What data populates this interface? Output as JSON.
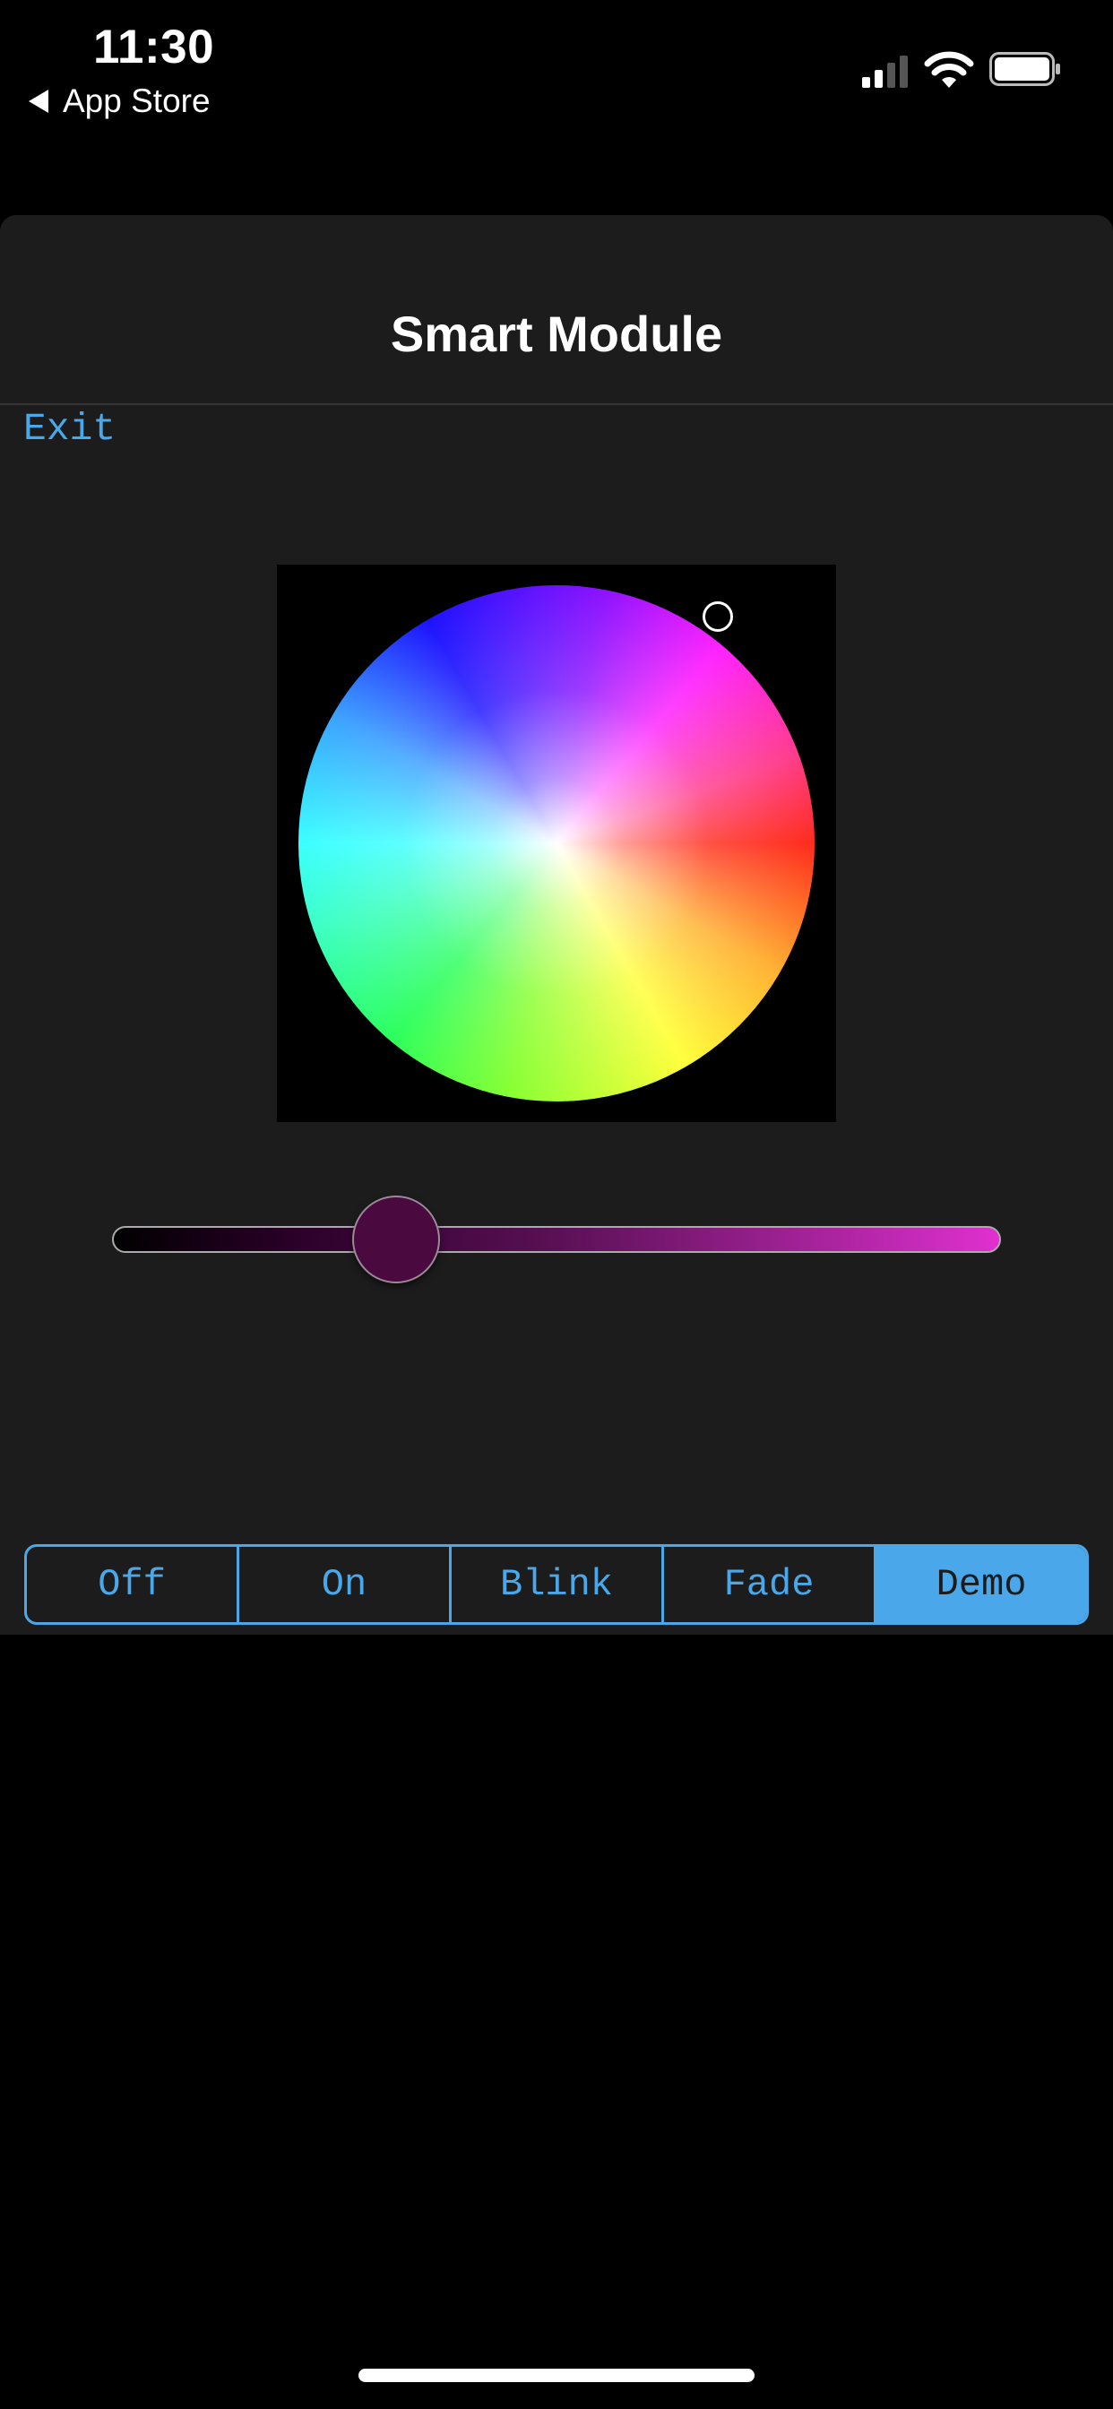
{
  "status_bar": {
    "time": "11:30",
    "back_label": "App Store",
    "signal_icon": "cellular-signal-icon",
    "wifi_icon": "wifi-icon",
    "battery_icon": "battery-icon"
  },
  "nav": {
    "title": "Smart Module",
    "exit_label": "Exit"
  },
  "color_picker": {
    "wheel_icon": "color-wheel",
    "selected_hue_color": "#ff30f0"
  },
  "brightness_slider": {
    "value_fraction": 0.32,
    "thumb_color": "#4a0a3f",
    "max_color": "#e030d0"
  },
  "mode_control": {
    "options": [
      "Off",
      "On",
      "Blink",
      "Fade",
      "Demo"
    ],
    "selected": "Demo",
    "accent_color": "#4aa8ea"
  }
}
